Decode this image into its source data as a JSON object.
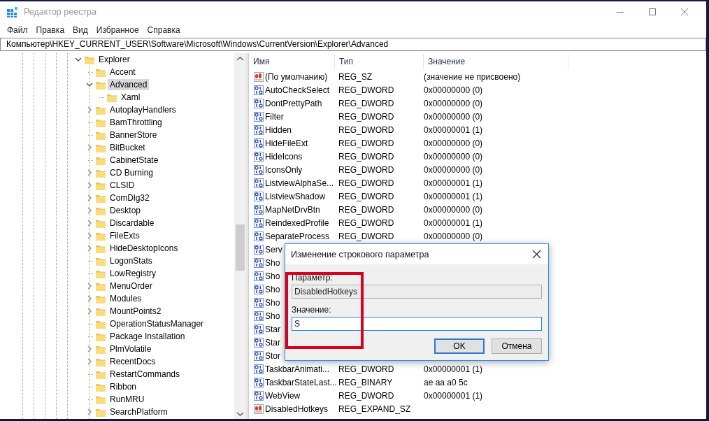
{
  "window": {
    "title": "Редактор реестра"
  },
  "menu": [
    "Файл",
    "Правка",
    "Вид",
    "Избранное",
    "Справка"
  ],
  "address": "Компьютер\\HKEY_CURRENT_USER\\Software\\Microsoft\\Windows\\CurrentVersion\\Explorer\\Advanced",
  "tree": [
    {
      "label": "Explorer",
      "expandable": true,
      "expanded": true,
      "selected": false,
      "children": [
        {
          "label": "Accent",
          "expandable": false,
          "selected": false
        },
        {
          "label": "Advanced",
          "expandable": true,
          "expanded": true,
          "selected": true,
          "children": [
            {
              "label": "Xaml",
              "expandable": false,
              "selected": false
            }
          ]
        },
        {
          "label": "AutoplayHandlers",
          "expandable": true,
          "expanded": false,
          "selected": false
        },
        {
          "label": "BamThrottling",
          "expandable": false,
          "selected": false
        },
        {
          "label": "BannerStore",
          "expandable": false,
          "selected": false
        },
        {
          "label": "BitBucket",
          "expandable": true,
          "expanded": false,
          "selected": false
        },
        {
          "label": "CabinetState",
          "expandable": false,
          "selected": false
        },
        {
          "label": "CD Burning",
          "expandable": true,
          "expanded": false,
          "selected": false
        },
        {
          "label": "CLSID",
          "expandable": true,
          "expanded": false,
          "selected": false
        },
        {
          "label": "ComDlg32",
          "expandable": true,
          "expanded": false,
          "selected": false
        },
        {
          "label": "Desktop",
          "expandable": true,
          "expanded": false,
          "selected": false
        },
        {
          "label": "Discardable",
          "expandable": true,
          "expanded": false,
          "selected": false
        },
        {
          "label": "FileExts",
          "expandable": true,
          "expanded": false,
          "selected": false
        },
        {
          "label": "HideDesktopIcons",
          "expandable": true,
          "expanded": false,
          "selected": false
        },
        {
          "label": "LogonStats",
          "expandable": false,
          "selected": false
        },
        {
          "label": "LowRegistry",
          "expandable": false,
          "selected": false
        },
        {
          "label": "MenuOrder",
          "expandable": true,
          "expanded": false,
          "selected": false
        },
        {
          "label": "Modules",
          "expandable": true,
          "expanded": false,
          "selected": false
        },
        {
          "label": "MountPoints2",
          "expandable": true,
          "expanded": false,
          "selected": false
        },
        {
          "label": "OperationStatusManager",
          "expandable": false,
          "selected": false
        },
        {
          "label": "Package Installation",
          "expandable": false,
          "selected": false
        },
        {
          "label": "PlmVolatile",
          "expandable": true,
          "expanded": false,
          "selected": false
        },
        {
          "label": "RecentDocs",
          "expandable": true,
          "expanded": false,
          "selected": false
        },
        {
          "label": "RestartCommands",
          "expandable": false,
          "selected": false
        },
        {
          "label": "Ribbon",
          "expandable": false,
          "selected": false
        },
        {
          "label": "RunMRU",
          "expandable": false,
          "selected": false
        },
        {
          "label": "SearchPlatform",
          "expandable": true,
          "expanded": false,
          "selected": false
        }
      ]
    }
  ],
  "list": {
    "columns": [
      "Имя",
      "Тип",
      "Значение"
    ],
    "rows": [
      {
        "kind": "string",
        "name": "(По умолчанию)",
        "type": "REG_SZ",
        "value": "(значение не присвоено)"
      },
      {
        "kind": "binary",
        "name": "AutoCheckSelect",
        "type": "REG_DWORD",
        "value": "0x00000000 (0)"
      },
      {
        "kind": "binary",
        "name": "DontPrettyPath",
        "type": "REG_DWORD",
        "value": "0x00000000 (0)"
      },
      {
        "kind": "binary",
        "name": "Filter",
        "type": "REG_DWORD",
        "value": "0x00000000 (0)"
      },
      {
        "kind": "binary",
        "name": "Hidden",
        "type": "REG_DWORD",
        "value": "0x00000001 (1)"
      },
      {
        "kind": "binary",
        "name": "HideFileExt",
        "type": "REG_DWORD",
        "value": "0x00000000 (0)"
      },
      {
        "kind": "binary",
        "name": "HideIcons",
        "type": "REG_DWORD",
        "value": "0x00000000 (0)"
      },
      {
        "kind": "binary",
        "name": "IconsOnly",
        "type": "REG_DWORD",
        "value": "0x00000000 (0)"
      },
      {
        "kind": "binary",
        "name": "ListviewAlphaSe...",
        "type": "REG_DWORD",
        "value": "0x00000001 (1)"
      },
      {
        "kind": "binary",
        "name": "ListviewShadow",
        "type": "REG_DWORD",
        "value": "0x00000001 (1)"
      },
      {
        "kind": "binary",
        "name": "MapNetDrvBtn",
        "type": "REG_DWORD",
        "value": "0x00000000 (0)"
      },
      {
        "kind": "binary",
        "name": "ReindexedProfile",
        "type": "REG_DWORD",
        "value": "0x00000001 (1)"
      },
      {
        "kind": "binary",
        "name": "SeparateProcess",
        "type": "REG_DWORD",
        "value": "0x00000000 (0)"
      },
      {
        "kind": "binary",
        "name": "Serv"
      },
      {
        "kind": "binary",
        "name": "Sho"
      },
      {
        "kind": "binary",
        "name": "Sho"
      },
      {
        "kind": "binary",
        "name": "Sho"
      },
      {
        "kind": "binary",
        "name": "Sho"
      },
      {
        "kind": "binary",
        "name": "Sho"
      },
      {
        "kind": "binary",
        "name": "Star"
      },
      {
        "kind": "binary",
        "name": "Star"
      },
      {
        "kind": "binary",
        "name": "Stor"
      },
      {
        "kind": "binary",
        "name": "TaskbarAnimati...",
        "type": "REG_DWORD",
        "value": "0x00000001 (1)"
      },
      {
        "kind": "binary",
        "name": "TaskbarStateLast...",
        "type": "REG_BINARY",
        "value": "ae aa a0 5c"
      },
      {
        "kind": "binary",
        "name": "WebView",
        "type": "REG_DWORD",
        "value": "0x00000001 (1)"
      },
      {
        "kind": "string",
        "name": "DisabledHotkeys",
        "type": "REG_EXPAND_SZ"
      }
    ]
  },
  "dialog": {
    "title": "Изменение строкового параметра",
    "name_label": "Параметр:",
    "name_value": "DisabledHotkeys",
    "value_label": "Значение:",
    "value": "S",
    "buttons": [
      {
        "label": "OK",
        "default": true
      },
      {
        "label": "Отмена",
        "default": false
      }
    ]
  }
}
